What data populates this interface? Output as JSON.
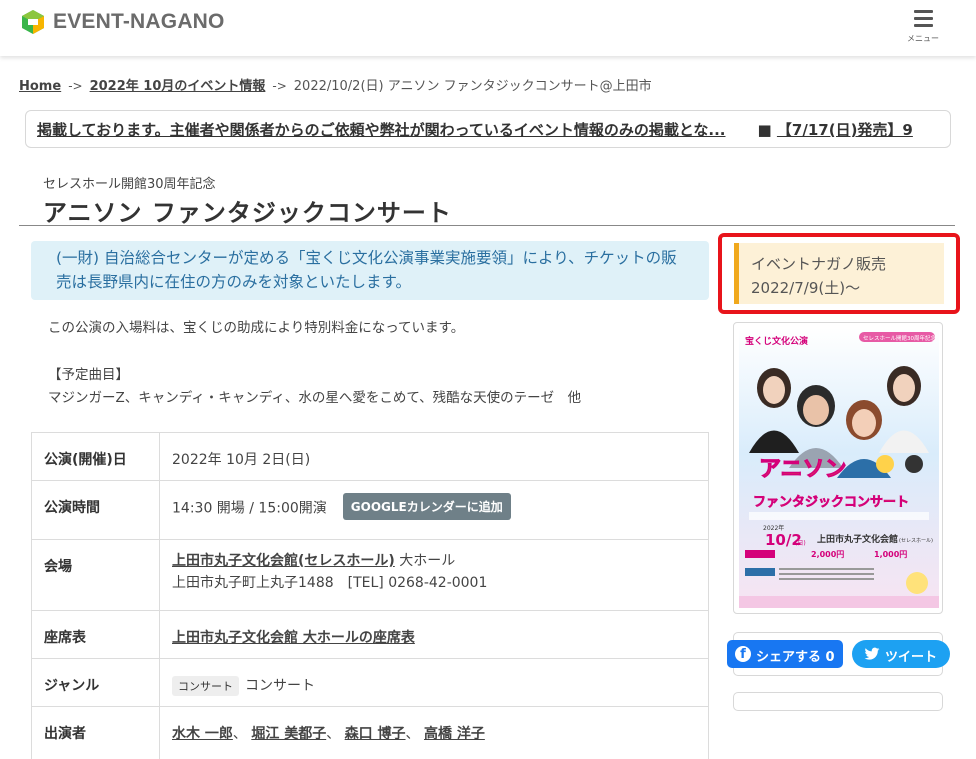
{
  "header": {
    "logo_text": "EVENT-NAGANO",
    "menu_label": "メニュー",
    "logo_colors": [
      "#8cc63f",
      "#39b54a",
      "#f7b500"
    ]
  },
  "breadcrumb": {
    "home": "Home",
    "sep": "->",
    "month": "2022年 10月のイベント情報",
    "current": "2022/10/2(日) アニソン ファンタジックコンサート@上田市"
  },
  "ticker": {
    "message1": "掲載しております。主催者や関係者からのご依頼や弊社が関わっているイベント情報のみの掲載とな...",
    "prefix2": "■",
    "message2": "【7/17(日)発売】9"
  },
  "event": {
    "subtitle": "セレスホール開館30周年記念",
    "title": "アニソン ファンタジックコンサート",
    "notice": "(一財) 自治総合センターが定める「宝くじ文化公演事業実施要領」により、チケットの販売は長野県内に在住の方のみを対象といたします。",
    "description": "この公演の入場料は、宝くじの助成により特別料金になっています。",
    "songs_header": "【予定曲目】",
    "songs": "マジンガーZ、キャンディ・キャンディ、水の星へ愛をこめて、残酷な天使のテーゼ　他"
  },
  "info": {
    "date_label": "公演(開催)日",
    "date_value": "2022年 10月 2日(日)",
    "time_label": "公演時間",
    "time_value": "14:30 開場 / 15:00開演",
    "gcal_button": "GOOGLEカレンダーに追加",
    "venue_label": "会場",
    "venue_link": "上田市丸子文化会館(セレスホール)",
    "venue_hall": "大ホール",
    "venue_address": "上田市丸子町上丸子1488　[TEL] 0268-42-0001",
    "seat_label": "座席表",
    "seat_link": "上田市丸子文化会館 大ホールの座席表",
    "genre_label": "ジャンル",
    "genre_tag": "コンサート",
    "genre_value": "コンサート",
    "performers_label": "出演者",
    "performers": [
      "水木 一郎",
      "堀江 美都子",
      "森口 博子",
      "高橋 洋子"
    ],
    "performer_sep": "、"
  },
  "sale": {
    "line1": "イベントナガノ販売",
    "line2": "2022/7/9(土)〜",
    "border_color": "#e8141b",
    "accent_color": "#f0a81c"
  },
  "poster": {
    "top_label": "宝くじ文化公演",
    "anniv": "セレスホール開館30周年記念",
    "title1": "アニソン",
    "title2": "ファンタジックコンサート",
    "date": "10/2",
    "dow": "(日)",
    "year": "2022年",
    "venue": "上田市丸子文化会館",
    "venue_sub": "(セレスホール)",
    "price1": "2,000円",
    "price2": "1,000円"
  },
  "share": {
    "facebook_label": "シェアする",
    "facebook_count": "0",
    "twitter_label": "ツイート"
  }
}
